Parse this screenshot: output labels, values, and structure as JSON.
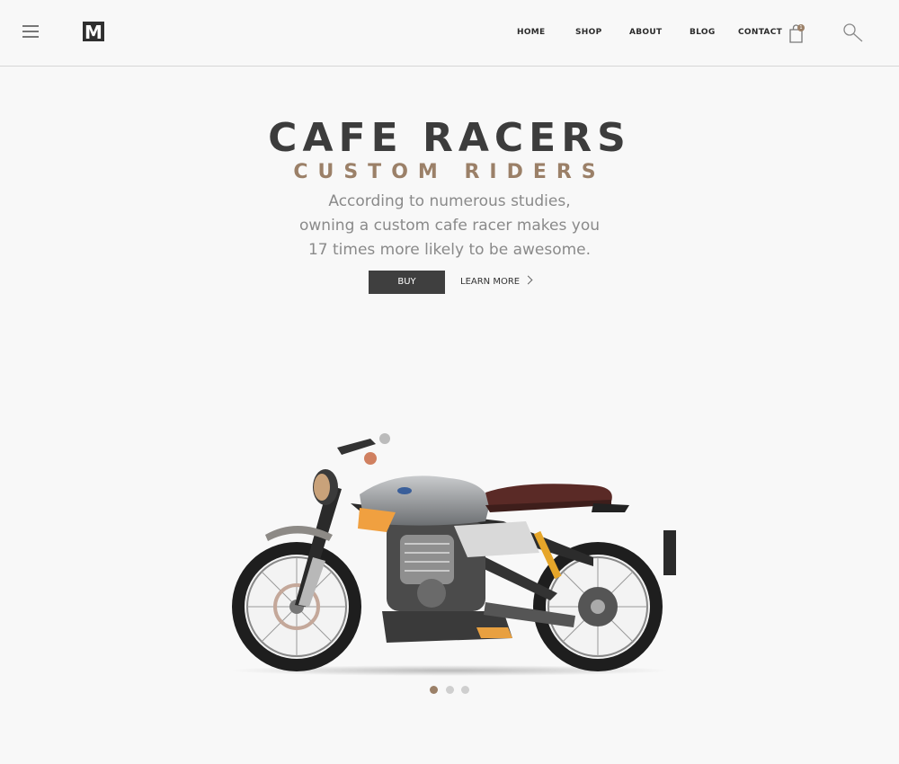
{
  "header": {
    "logo_letter": "M",
    "nav": [
      {
        "label": "HOME"
      },
      {
        "label": "SHOP"
      },
      {
        "label": "ABOUT"
      },
      {
        "label": "BLOG"
      },
      {
        "label": "CONTACT"
      }
    ],
    "cart_count": "1"
  },
  "hero": {
    "title": "CAFE RACERS",
    "subtitle": "CUSTOM RIDERS",
    "description_lines": [
      "According to numerous studies,",
      "owning a custom cafe racer makes you",
      "17 times more likely to be awesome."
    ],
    "buy_label": "BUY",
    "learn_more_label": "LEARN MORE"
  },
  "slider": {
    "dot_count": 3,
    "active_index": 0
  },
  "colors": {
    "accent": "#9b8068",
    "dark": "#3f3f3f",
    "background": "#f8f8f8"
  }
}
